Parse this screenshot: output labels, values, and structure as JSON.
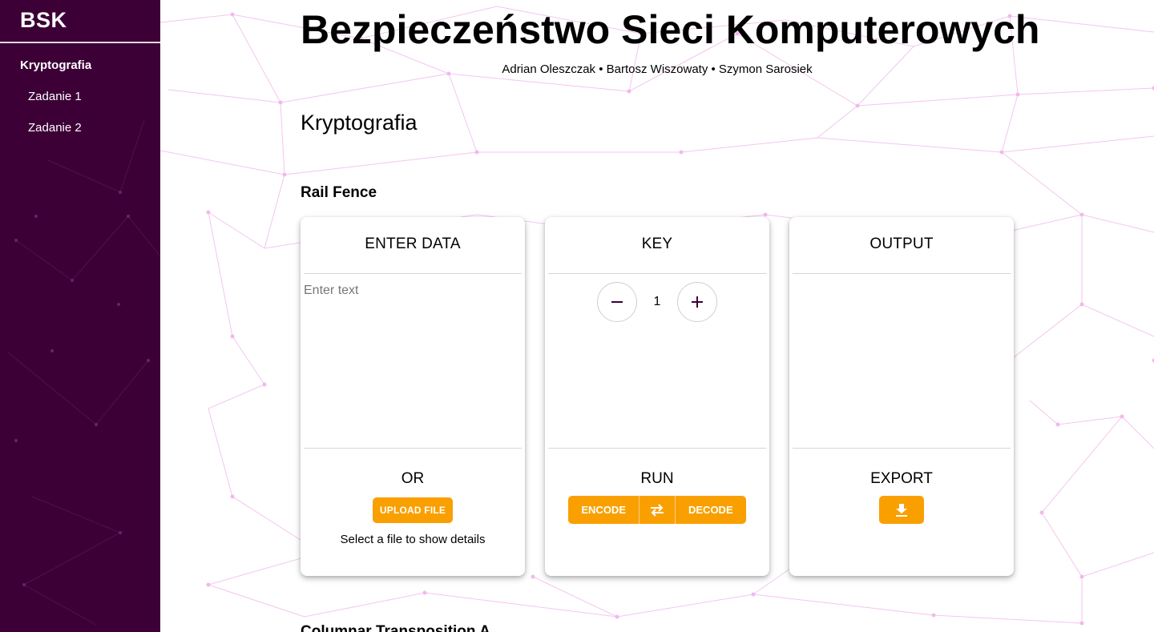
{
  "sidebar": {
    "brand": "BSK",
    "items": [
      {
        "label": "Kryptografia"
      },
      {
        "label": "Zadanie 1"
      },
      {
        "label": "Zadanie 2"
      }
    ]
  },
  "header": {
    "title": "Bezpieczeństwo Sieci Komputerowych",
    "authors": "Adrian Oleszczak • Bartosz Wiszowaty • Szymon Sarosiek"
  },
  "section": {
    "title": "Kryptografia",
    "subsection": "Rail Fence",
    "next_subsection": "Columnar Transposition A"
  },
  "cards": {
    "input": {
      "title": "ENTER DATA",
      "placeholder": "Enter text",
      "value": "",
      "or_label": "OR",
      "upload_label": "UPLOAD FILE",
      "file_hint": "Select a file to show details"
    },
    "key": {
      "title": "KEY",
      "value": "1",
      "decrement_icon": "minus-icon",
      "increment_icon": "plus-icon",
      "run_label": "RUN",
      "encode_label": "ENCODE",
      "swap_icon": "swap-arrows-icon",
      "decode_label": "DECODE"
    },
    "output": {
      "title": "OUTPUT",
      "value": "",
      "export_label": "EXPORT",
      "export_icon": "download-icon"
    }
  },
  "colors": {
    "sidebar_bg": "#3c0036",
    "accent": "#f9a000",
    "network_lines": "#f3c6ef"
  }
}
